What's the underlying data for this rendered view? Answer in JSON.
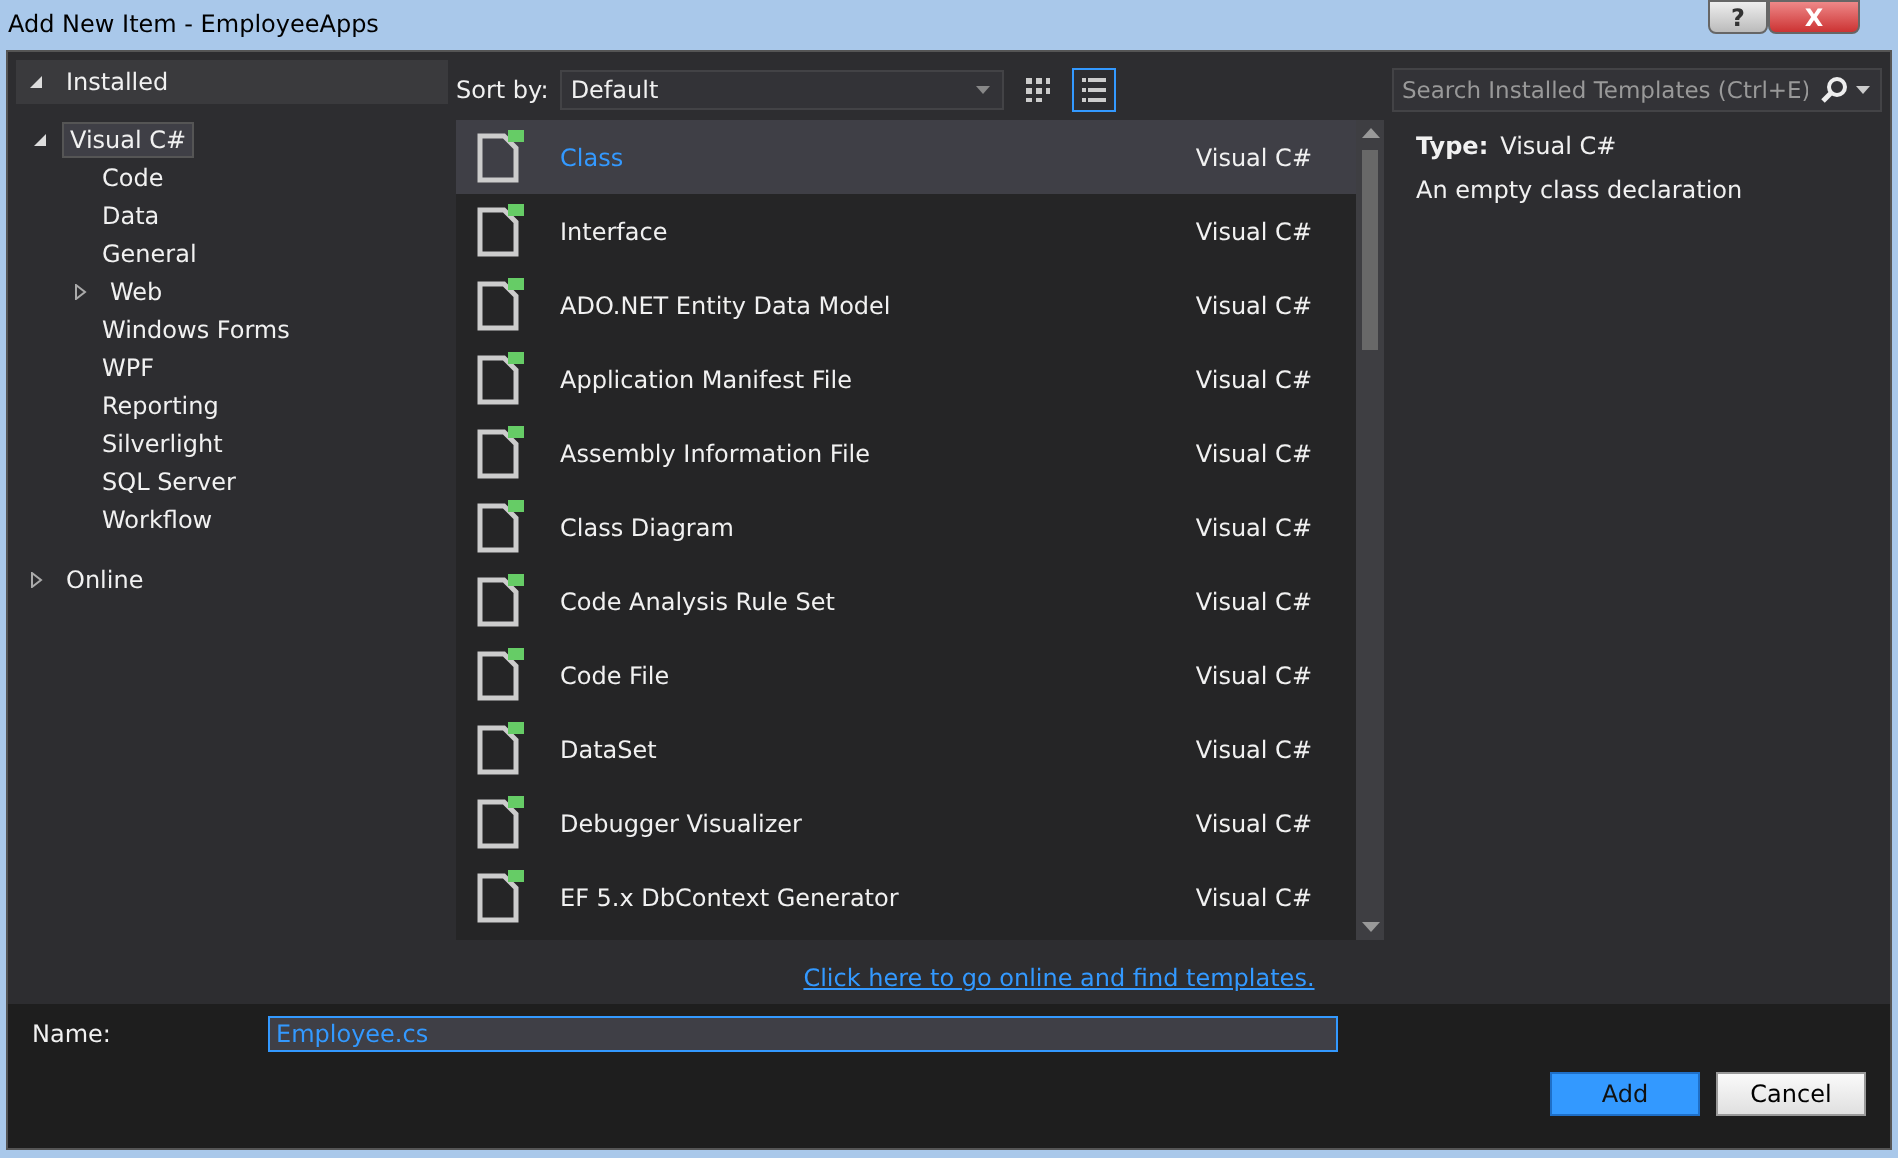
{
  "window": {
    "title": "Add New Item - EmployeeApps",
    "buttons": [
      {
        "kind": "help",
        "label": "?"
      },
      {
        "kind": "close",
        "label": "X"
      }
    ]
  },
  "tree": [
    {
      "label": "Installed",
      "expanded": true,
      "selected": false,
      "children": [
        {
          "label": "Visual C#",
          "expanded": true,
          "selected": true,
          "children": [
            {
              "label": "Code",
              "selected": false
            },
            {
              "label": "Data",
              "selected": false
            },
            {
              "label": "General",
              "selected": false
            },
            {
              "label": "Web",
              "expanded": false,
              "selected": false
            },
            {
              "label": "Windows Forms",
              "selected": false
            },
            {
              "label": "WPF",
              "selected": false
            },
            {
              "label": "Reporting",
              "selected": false
            },
            {
              "label": "Silverlight",
              "selected": false
            },
            {
              "label": "SQL Server",
              "selected": false
            },
            {
              "label": "Workflow",
              "selected": false
            }
          ]
        }
      ]
    },
    {
      "label": "Online",
      "expanded": false,
      "selected": false
    }
  ],
  "toolbar": {
    "sort_label": "Sort by:",
    "sort_value": "Default",
    "views": [
      {
        "kind": "grid",
        "selected": false
      },
      {
        "kind": "list",
        "selected": true
      }
    ],
    "search": {
      "placeholder": "Search Installed Templates (Ctrl+E)"
    }
  },
  "templates": [
    {
      "name": "Class",
      "language": "Visual C#",
      "selected": true
    },
    {
      "name": "Interface",
      "language": "Visual C#",
      "selected": false
    },
    {
      "name": "ADO.NET Entity Data Model",
      "language": "Visual C#",
      "selected": false
    },
    {
      "name": "Application Manifest File",
      "language": "Visual C#",
      "selected": false
    },
    {
      "name": "Assembly Information File",
      "language": "Visual C#",
      "selected": false
    },
    {
      "name": "Class Diagram",
      "language": "Visual C#",
      "selected": false
    },
    {
      "name": "Code Analysis Rule Set",
      "language": "Visual C#",
      "selected": false
    },
    {
      "name": "Code File",
      "language": "Visual C#",
      "selected": false
    },
    {
      "name": "DataSet",
      "language": "Visual C#",
      "selected": false
    },
    {
      "name": "Debugger Visualizer",
      "language": "Visual C#",
      "selected": false
    },
    {
      "name": "EF 5.x DbContext Generator",
      "language": "Visual C#",
      "selected": false
    }
  ],
  "details": {
    "type_label": "Type:",
    "type_value": "Visual C#",
    "description": "An empty class declaration"
  },
  "online_link": "Click here to go online and find templates.",
  "name_field": {
    "label": "Name:",
    "value": "Employee.cs"
  },
  "buttons": [
    {
      "label": "Add",
      "primary": true
    },
    {
      "label": "Cancel",
      "primary": false
    }
  ]
}
